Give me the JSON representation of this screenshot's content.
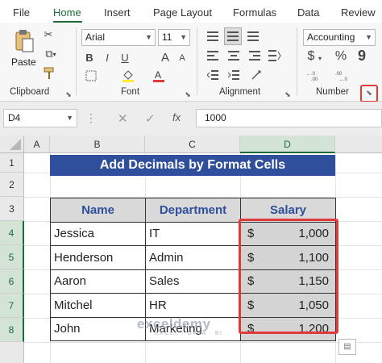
{
  "menu": {
    "tabs": [
      "File",
      "Home",
      "Insert",
      "Page Layout",
      "Formulas",
      "Data",
      "Review"
    ],
    "active": "Home"
  },
  "ribbon": {
    "clipboard": {
      "label": "Clipboard",
      "paste_label": "Paste"
    },
    "font": {
      "label": "Font",
      "font_name": "Arial",
      "font_size": "11",
      "bold": "B",
      "italic": "I",
      "underline": "U",
      "grow": "A",
      "shrink": "A"
    },
    "alignment": {
      "label": "Alignment"
    },
    "number": {
      "label": "Number",
      "format": "Accounting",
      "currency": "$",
      "percent": "%",
      "comma": "9"
    }
  },
  "formula_bar": {
    "name_box": "D4",
    "fx": "fx",
    "value": "1000"
  },
  "columns": [
    "A",
    "B",
    "C",
    "D"
  ],
  "rows": [
    "1",
    "2",
    "3",
    "4",
    "5",
    "6",
    "7",
    "8"
  ],
  "sheet": {
    "title": "Add Decimals by Format Cells",
    "headers": {
      "name": "Name",
      "department": "Department",
      "salary": "Salary"
    },
    "records": [
      {
        "name": "Jessica",
        "department": "IT",
        "currency": "$",
        "salary": "1,000"
      },
      {
        "name": "Henderson",
        "department": "Admin",
        "currency": "$",
        "salary": "1,100"
      },
      {
        "name": "Aaron",
        "department": "Sales",
        "currency": "$",
        "salary": "1,150"
      },
      {
        "name": "Mitchel",
        "department": "HR",
        "currency": "$",
        "salary": "1,050"
      },
      {
        "name": "John",
        "department": "Marketing",
        "currency": "$",
        "salary": "1,200"
      }
    ]
  },
  "watermark": {
    "main": "exceldemy",
    "sub": "EXCEL · DATA · BI"
  },
  "colors": {
    "accent": "#1e6b3a",
    "title_bg": "#2f4e9c",
    "highlight": "#e03a3a"
  }
}
